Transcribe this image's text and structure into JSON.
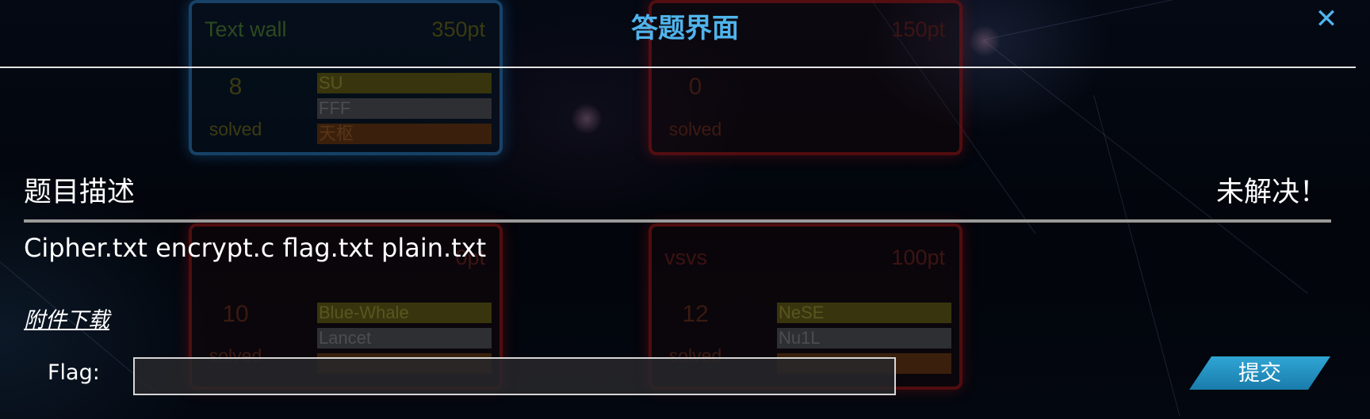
{
  "modal": {
    "title": "答题界面",
    "close_icon": "close-icon",
    "section_title": "题目描述",
    "status": "未解决！",
    "description": "Cipher.txt encrypt.c flag.txt plain.txt",
    "attachment_link": "附件下载",
    "flag_label": "Flag:",
    "flag_value": "",
    "flag_placeholder": "",
    "submit_label": "提交"
  },
  "background_cards": [
    {
      "title": "Text wall",
      "points": "350pt",
      "solved_count": "8",
      "solved_label": "solved",
      "teams": [
        "SU",
        "FFF",
        "天枢"
      ]
    },
    {
      "title": "",
      "points": "150pt",
      "solved_count": "0",
      "solved_label": "solved",
      "teams": []
    },
    {
      "title": "",
      "points": "0pt",
      "solved_count": "10",
      "solved_label": "solved",
      "teams": [
        "Blue-Whale",
        "Lancet",
        ""
      ]
    },
    {
      "title": "vsvs",
      "points": "100pt",
      "solved_count": "12",
      "solved_label": "solved",
      "teams": [
        "NeSE",
        "Nu1L",
        ""
      ]
    }
  ],
  "colors": {
    "accent": "#4fb4ec",
    "submit": "#1f8fc2",
    "text": "#ffffff",
    "rule": "#9a9a9a",
    "background": "#02050b"
  }
}
